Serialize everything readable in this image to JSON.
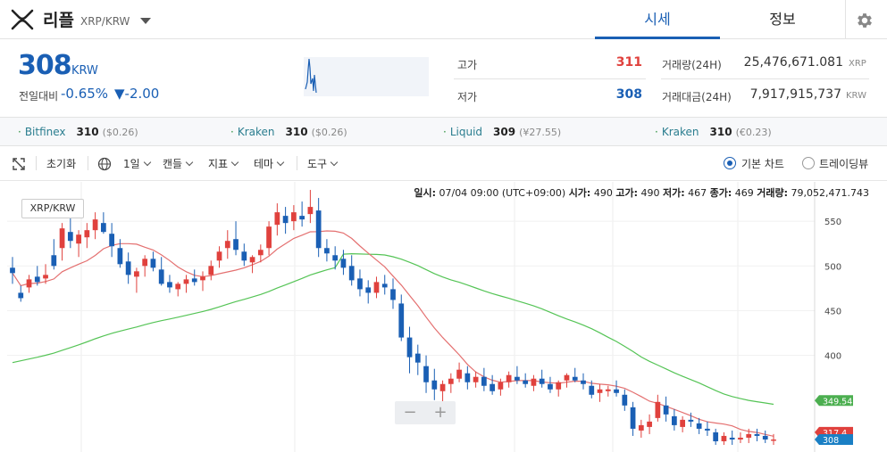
{
  "header": {
    "coin_name": "리플",
    "pair": "XRP/KRW",
    "tabs": [
      {
        "label": "시세",
        "active": true
      },
      {
        "label": "정보",
        "active": false
      }
    ]
  },
  "price": {
    "current": "308",
    "unit": "KRW",
    "change_label": "전일대비",
    "change_pct": "-0.65%",
    "change_val": "▼-2.00"
  },
  "stats": {
    "high_label": "고가",
    "high": "311",
    "low_label": "저가",
    "low": "308",
    "volume_label": "거래량(24H)",
    "volume": "25,476,671.081",
    "volume_unit": "XRP",
    "amount_label": "거래대금(24H)",
    "amount": "7,917,915,737",
    "amount_unit": "KRW"
  },
  "exchanges": [
    {
      "name": "Bitfinex",
      "price": "310",
      "sub": "($0.26)"
    },
    {
      "name": "Kraken",
      "price": "310",
      "sub": "($0.26)"
    },
    {
      "name": "Liquid",
      "price": "309",
      "sub": "(¥27.55)"
    },
    {
      "name": "Kraken",
      "price": "310",
      "sub": "(€0.23)"
    }
  ],
  "toolbar": {
    "reset": "초기화",
    "interval": "1일",
    "candle": "캔들",
    "indicator": "지표",
    "theme": "테마",
    "tools": "도구",
    "basic_chart": "기본 차트",
    "trading_view": "트레이딩뷰"
  },
  "ohlc_line": {
    "date_label": "일시:",
    "date": "07/04 09:00 (UTC+09:00)",
    "open_label": "시가:",
    "open": "490",
    "high_label": "고가:",
    "high": "490",
    "low_label": "저가:",
    "low": "467",
    "close_label": "종가:",
    "close": "469",
    "vol_label": "거래량:",
    "vol": "79,052,471.743"
  },
  "chart_badge": "XRP/KRW",
  "colors": {
    "up": "#e0413d",
    "down": "#1a5fb4",
    "ma_short": "#e47070",
    "ma_long": "#55c456",
    "accent": "#1a5fb4"
  },
  "chart_data": {
    "type": "candlestick",
    "ylim": [
      292,
      594
    ],
    "y_ticks": [
      550,
      500,
      450,
      400
    ],
    "markers": [
      {
        "label": "349.54",
        "value": 349.5,
        "color": "#4caf50"
      },
      {
        "label": "317.4",
        "value": 314,
        "color": "#e0413d"
      },
      {
        "label": "308",
        "value": 306,
        "color": "#1a7fc4"
      }
    ],
    "candles": [
      [
        498,
        510,
        480,
        492
      ],
      [
        470,
        478,
        460,
        464
      ],
      [
        476,
        490,
        470,
        485
      ],
      [
        488,
        500,
        478,
        482
      ],
      [
        486,
        502,
        480,
        490
      ],
      [
        512,
        530,
        496,
        500
      ],
      [
        520,
        548,
        506,
        542
      ],
      [
        538,
        555,
        520,
        528
      ],
      [
        525,
        540,
        510,
        535
      ],
      [
        532,
        548,
        520,
        540
      ],
      [
        540,
        560,
        530,
        552
      ],
      [
        548,
        560,
        536,
        538
      ],
      [
        536,
        548,
        510,
        522
      ],
      [
        520,
        530,
        498,
        502
      ],
      [
        505,
        515,
        480,
        490
      ],
      [
        488,
        498,
        470,
        494
      ],
      [
        500,
        512,
        488,
        508
      ],
      [
        508,
        516,
        494,
        498
      ],
      [
        496,
        510,
        478,
        480
      ],
      [
        482,
        490,
        470,
        476
      ],
      [
        474,
        482,
        466,
        480
      ],
      [
        480,
        490,
        470,
        485
      ],
      [
        486,
        496,
        478,
        482
      ],
      [
        484,
        494,
        472,
        488
      ],
      [
        490,
        506,
        484,
        500
      ],
      [
        506,
        522,
        498,
        516
      ],
      [
        520,
        540,
        508,
        528
      ],
      [
        530,
        550,
        512,
        518
      ],
      [
        516,
        525,
        500,
        506
      ],
      [
        504,
        512,
        492,
        510
      ],
      [
        512,
        524,
        504,
        518
      ],
      [
        520,
        550,
        512,
        544
      ],
      [
        546,
        570,
        534,
        560
      ],
      [
        556,
        566,
        536,
        548
      ],
      [
        550,
        568,
        540,
        560
      ],
      [
        556,
        572,
        544,
        552
      ],
      [
        558,
        585,
        548,
        566
      ],
      [
        562,
        576,
        510,
        520
      ],
      [
        520,
        530,
        505,
        514
      ],
      [
        512,
        522,
        496,
        506
      ],
      [
        508,
        518,
        490,
        498
      ],
      [
        500,
        512,
        478,
        484
      ],
      [
        486,
        496,
        466,
        474
      ],
      [
        476,
        484,
        458,
        470
      ],
      [
        470,
        488,
        464,
        482
      ],
      [
        480,
        490,
        468,
        476
      ],
      [
        474,
        486,
        452,
        462
      ],
      [
        458,
        468,
        416,
        420
      ],
      [
        420,
        432,
        380,
        398
      ],
      [
        402,
        412,
        378,
        392
      ],
      [
        388,
        400,
        358,
        370
      ],
      [
        372,
        385,
        350,
        362
      ],
      [
        360,
        372,
        348,
        368
      ],
      [
        368,
        380,
        358,
        374
      ],
      [
        374,
        392,
        370,
        384
      ],
      [
        380,
        388,
        362,
        370
      ],
      [
        370,
        382,
        364,
        376
      ],
      [
        376,
        386,
        360,
        366
      ],
      [
        368,
        378,
        356,
        360
      ],
      [
        362,
        374,
        355,
        370
      ],
      [
        370,
        382,
        364,
        378
      ],
      [
        376,
        388,
        368,
        372
      ],
      [
        372,
        380,
        364,
        368
      ],
      [
        366,
        378,
        360,
        374
      ],
      [
        374,
        384,
        364,
        368
      ],
      [
        368,
        376,
        358,
        362
      ],
      [
        362,
        372,
        354,
        370
      ],
      [
        372,
        380,
        364,
        378
      ],
      [
        376,
        386,
        370,
        372
      ],
      [
        372,
        380,
        362,
        368
      ],
      [
        366,
        372,
        352,
        356
      ],
      [
        358,
        368,
        348,
        362
      ],
      [
        360,
        366,
        354,
        362
      ],
      [
        362,
        372,
        354,
        358
      ],
      [
        356,
        362,
        338,
        344
      ],
      [
        342,
        348,
        310,
        318
      ],
      [
        316,
        328,
        308,
        322
      ],
      [
        320,
        334,
        312,
        326
      ],
      [
        330,
        356,
        326,
        348
      ],
      [
        344,
        354,
        326,
        334
      ],
      [
        332,
        340,
        316,
        322
      ],
      [
        320,
        332,
        314,
        328
      ],
      [
        328,
        336,
        320,
        326
      ],
      [
        324,
        330,
        312,
        318
      ],
      [
        318,
        326,
        310,
        316
      ],
      [
        314,
        318,
        300,
        304
      ],
      [
        304,
        314,
        300,
        310
      ],
      [
        308,
        316,
        300,
        306
      ],
      [
        306,
        314,
        302,
        308
      ],
      [
        308,
        318,
        302,
        312
      ],
      [
        312,
        318,
        304,
        310
      ],
      [
        310,
        316,
        302,
        306
      ],
      [
        306,
        312,
        300,
        306
      ]
    ]
  }
}
